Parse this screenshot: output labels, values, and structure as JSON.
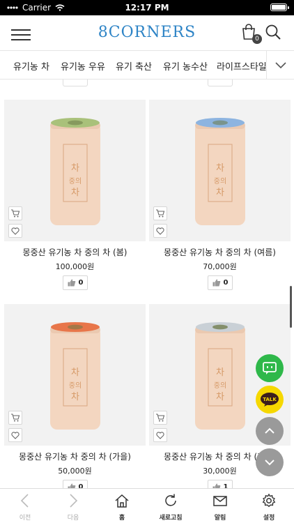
{
  "status": {
    "carrier": "Carrier",
    "time": "12:17 PM"
  },
  "header": {
    "logo": "8CORNERS",
    "cart_count": "0"
  },
  "tabs": [
    {
      "label": "유기농 차"
    },
    {
      "label": "유기농 우유"
    },
    {
      "label": "유기 축산"
    },
    {
      "label": "유기 농수산"
    },
    {
      "label": "라이프스타일"
    }
  ],
  "products": [
    {
      "name": "몽중산 유기농 차 중의 차 (봄)",
      "price": "100,000원",
      "likes": "0",
      "lid_color": "#a9c17a"
    },
    {
      "name": "몽중산 유기농 차 중의 차 (여름)",
      "price": "70,000원",
      "likes": "0",
      "lid_color": "#8db4e0"
    },
    {
      "name": "몽중산 유기농 차 중의 차 (가을)",
      "price": "50,000원",
      "likes": "0",
      "lid_color": "#e8764a"
    },
    {
      "name": "몽중산 유기농 차 중의 차 (겨울)",
      "price": "30,000원",
      "likes": "1",
      "lid_color": "#c9d0d6"
    }
  ],
  "bottom_nav": {
    "back": "이전",
    "forward": "다음",
    "home": "홈",
    "refresh": "새로고침",
    "notice": "알림",
    "settings": "설정"
  },
  "colors": {
    "brand": "#2e84c6",
    "chat": "#2fb84a",
    "talk": "#f6d800"
  },
  "floating": {
    "talk_label": "TALK"
  }
}
